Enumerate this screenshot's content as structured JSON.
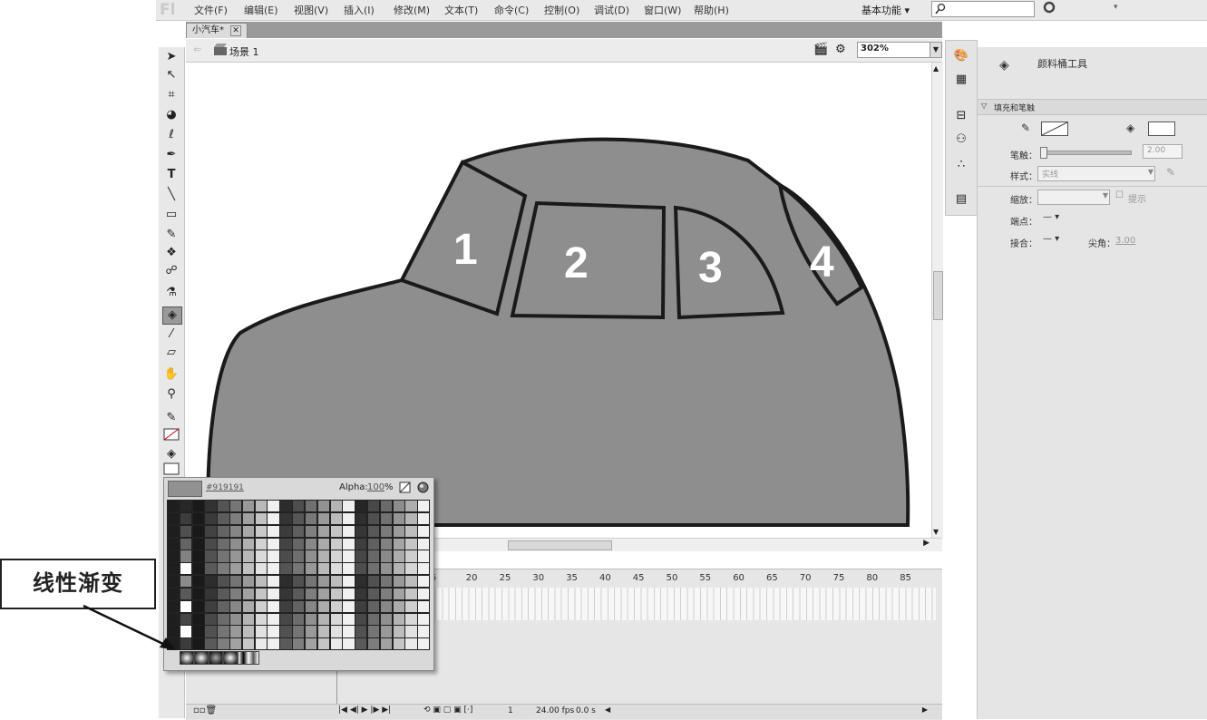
{
  "app": {
    "logo": "Fl"
  },
  "menu": [
    "文件(F)",
    "编辑(E)",
    "视图(V)",
    "插入(I)",
    "修改(M)",
    "文本(T)",
    "命令(C)",
    "控制(O)",
    "调试(D)",
    "窗口(W)",
    "帮助(H)"
  ],
  "workspace": {
    "label": "基本功能 ▾"
  },
  "document": {
    "tab_label": "小汽车*",
    "scene_label": "场景 1",
    "zoom": "302%"
  },
  "stage": {
    "window_labels": [
      "1",
      "2",
      "3",
      "4"
    ],
    "car_fill": "#8e8e8e",
    "outline": "#1a1a1a"
  },
  "tools_panel": {
    "active_tool": "paint-bucket"
  },
  "properties": {
    "tool_name": "颜料桶工具",
    "section_title": "填充和笔触",
    "stroke_label": "笔触：",
    "stroke_value": "2.00",
    "style_label": "样式：",
    "style_value": "实线",
    "scale_label": "缩放：",
    "hint_label": "提示",
    "cap_label": "端点：",
    "join_label": "接合：",
    "miter_label": "尖角：",
    "miter_value": "3.00"
  },
  "swatch_popup": {
    "hex": "#919191",
    "alpha_label": "Alpha:",
    "alpha_value": "100",
    "alpha_unit": "%"
  },
  "timeline": {
    "frame_numbers": [
      "5",
      "20",
      "25",
      "30",
      "35",
      "40",
      "45",
      "50",
      "55",
      "60",
      "65",
      "70",
      "75",
      "80",
      "85"
    ],
    "current_frame": "1",
    "fps": "24.00 fps",
    "elapsed": "0.0 s"
  },
  "callout": {
    "text": "线性渐变"
  }
}
